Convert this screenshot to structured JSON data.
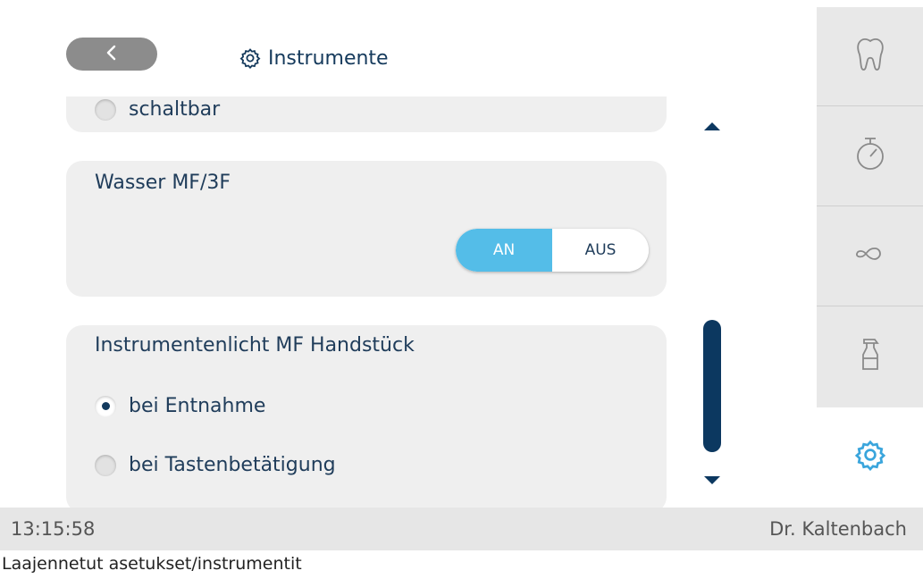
{
  "header": {
    "title": "Instrumente",
    "back_icon": "chevron-left-icon",
    "title_icon": "gear-icon"
  },
  "cards": {
    "partial": {
      "option": "schaltbar"
    },
    "water": {
      "title": "Wasser MF/3F",
      "toggle": {
        "on_label": "AN",
        "off_label": "AUS",
        "selected": "AN"
      }
    },
    "light": {
      "title": "Instrumentenlicht MF Handstück",
      "options": [
        "bei Entnahme",
        "bei Tastenbetätigung"
      ],
      "selected": "bei Entnahme"
    }
  },
  "sidebar": {
    "items": [
      {
        "icon": "tooth-icon"
      },
      {
        "icon": "stopwatch-icon"
      },
      {
        "icon": "infinity-icon"
      },
      {
        "icon": "spray-bottle-icon"
      }
    ],
    "active": {
      "icon": "gear-icon"
    }
  },
  "colors": {
    "accent": "#54bde8",
    "dark": "#0c3860",
    "card": "#efefef"
  },
  "status": {
    "time": "13:15:58",
    "user": "Dr. Kaltenbach"
  },
  "caption": "Laajennetut asetukset/instrumentit"
}
